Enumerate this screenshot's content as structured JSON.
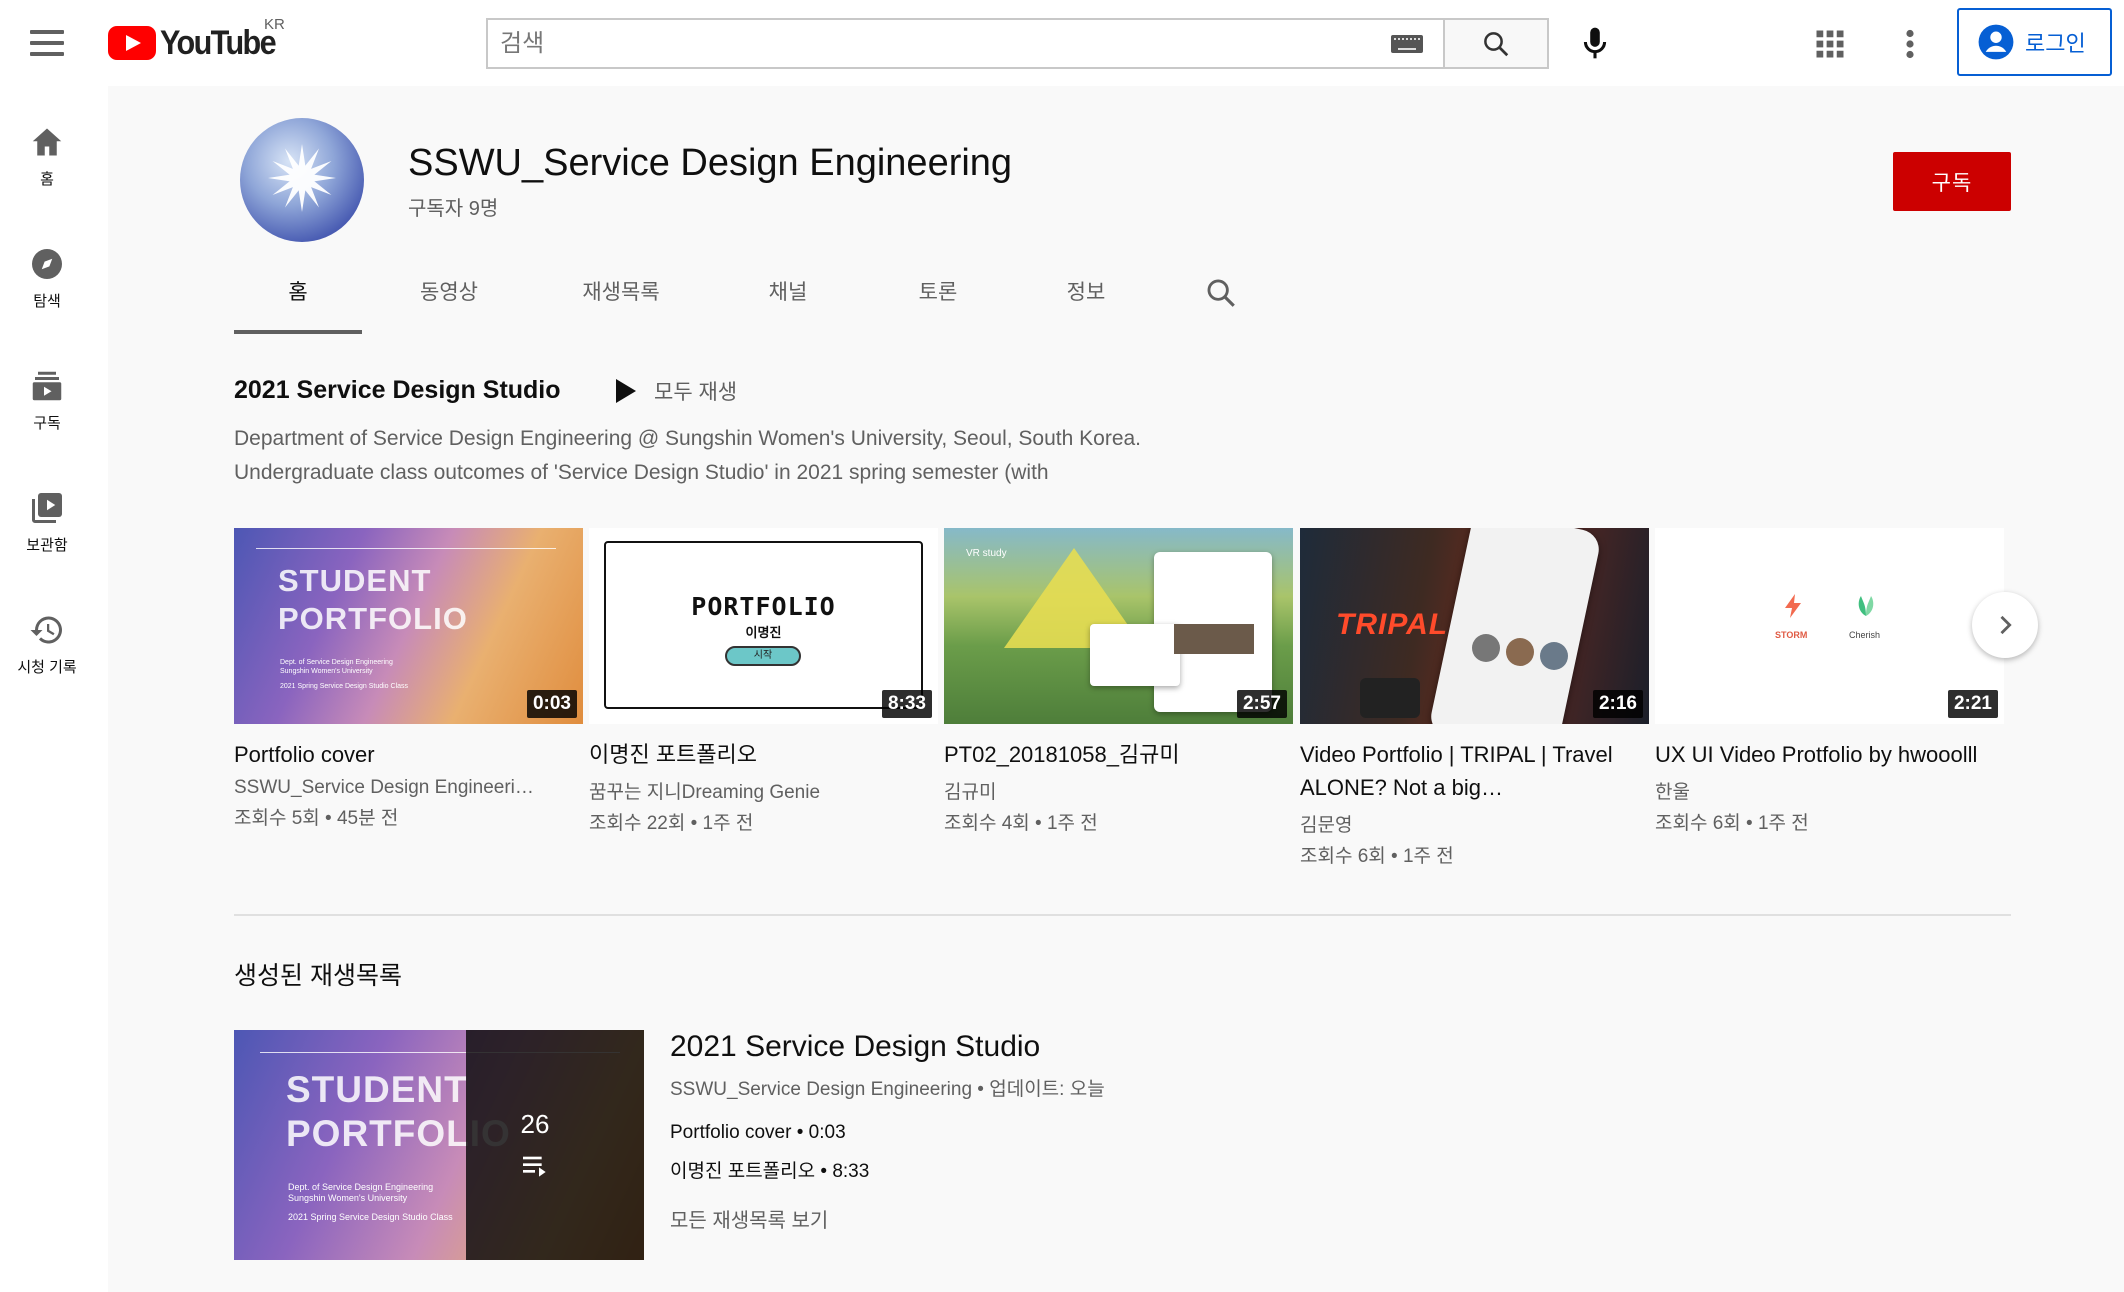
{
  "header": {
    "logo_text": "YouTube",
    "country": "KR",
    "search_placeholder": "검색",
    "login_label": "로그인"
  },
  "sidebar": {
    "items": [
      {
        "label": "홈",
        "icon": "home-icon"
      },
      {
        "label": "탐색",
        "icon": "compass-icon"
      },
      {
        "label": "구독",
        "icon": "subscriptions-icon"
      },
      {
        "label": "보관함",
        "icon": "library-icon"
      },
      {
        "label": "시청 기록",
        "icon": "history-icon"
      }
    ]
  },
  "channel": {
    "name": "SSWU_Service Design Engineering",
    "subscribers": "구독자 9명",
    "subscribe_label": "구독",
    "tabs": [
      "홈",
      "동영상",
      "재생목록",
      "채널",
      "토론",
      "정보"
    ],
    "active_tab": "홈"
  },
  "shelf": {
    "title": "2021 Service Design Studio",
    "play_all": "모두 재생",
    "desc_line1": "Department of Service Design Engineering @ Sungshin Women's University, Seoul, South Korea.",
    "desc_line2": "Undergraduate class outcomes of 'Service Design Studio' in 2021 spring semester (with",
    "videos": [
      {
        "title": "Portfolio cover",
        "channel": "SSWU_Service Design Engineeri…",
        "meta": "조회수 5회 • 45분 전",
        "duration": "0:03",
        "thumb_title": "STUDENT PORTFOLIO",
        "thumb_sub1": "Dept. of Service Design Engineering",
        "thumb_sub2": "Sungshin Women's University",
        "thumb_sub3": "2021 Spring Service Design Studio Class"
      },
      {
        "title": "이명진 포트폴리오",
        "channel": "꿈꾸는 지니Dreaming Genie",
        "meta": "조회수 22회 • 1주 전",
        "duration": "8:33",
        "thumb_title": "PORTFOLIO",
        "thumb_name": "이명진",
        "thumb_button": "시작"
      },
      {
        "title": "PT02_20181058_김규미",
        "channel": "김규미",
        "meta": "조회수 4회 • 1주 전",
        "duration": "2:57",
        "thumb_label": "VR study"
      },
      {
        "title": "Video Portfolio | TRIPAL | Travel ALONE? Not a big…",
        "channel": "김문영",
        "meta": "조회수 6회 • 1주 전",
        "duration": "2:16",
        "thumb_title": "TRIPAL"
      },
      {
        "title": "UX UI Video Protfolio by hwooolll",
        "channel": "한울",
        "meta": "조회수 6회 • 1주 전",
        "duration": "2:21",
        "thumb_app1": "STORM",
        "thumb_app2": "Cherish"
      }
    ]
  },
  "playlists": {
    "section_title": "생성된 재생목록",
    "title": "2021 Service Design Studio",
    "meta": "SSWU_Service Design Engineering • 업데이트: 오늘",
    "count": "26",
    "items": [
      "Portfolio cover • 0:03",
      "이명진 포트폴리오 • 8:33"
    ],
    "view_all": "모든 재생목록 보기",
    "thumb_title": "STUDENT PORTFOLIO",
    "thumb_sub1": "Dept. of Service Design Engineering",
    "thumb_sub2": "Sungshin Women's University",
    "thumb_sub3": "2021 Spring Service Design Studio Class"
  },
  "colors": {
    "brand_red": "#ff0000",
    "subscribe_red": "#cc0000",
    "link_blue": "#065fd4",
    "background": "#f9f9f9"
  }
}
